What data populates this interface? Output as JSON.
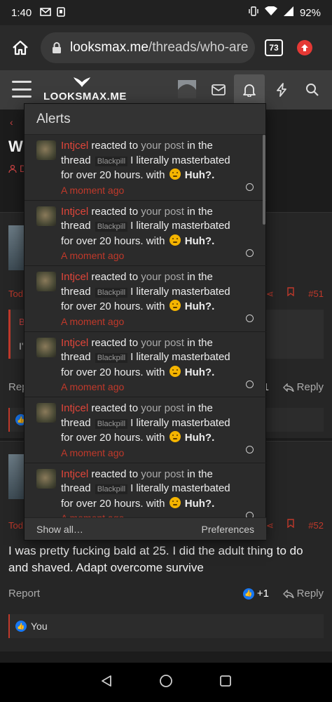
{
  "status_bar": {
    "time": "1:40",
    "battery": "92%"
  },
  "browser": {
    "url_domain": "looksmax.me",
    "url_path": "/threads/who-are",
    "tab_count": "73"
  },
  "site": {
    "logo_text": "LOOKSMAX.ME"
  },
  "background_page": {
    "title_fragment": "WI",
    "meta_fragment": "D",
    "back_fragment": "‹",
    "post1": {
      "date_fragment": "Tod",
      "number": "#51",
      "quote_fragment_a": "B",
      "quote_fragment_b": "I'",
      "report_fragment": "Rep",
      "plus": "1",
      "reply": "Reply"
    },
    "post2": {
      "date_fragment": "Tod",
      "number": "#52",
      "text": "I was pretty fucking bald at 25. I did the adult thing to do and shaved. Adapt overcome survive",
      "report": "Report",
      "plus": "+1",
      "reply": "Reply",
      "liked_by": "You"
    }
  },
  "alerts": {
    "title": "Alerts",
    "items": [
      {
        "user": "Intjcel",
        "action": "reacted to",
        "link": "your post",
        "context": "in the thread",
        "prefix": "Blackpill",
        "thread": "I literally masterbated for over 20 hours.",
        "with": "with",
        "reaction": "Huh?.",
        "time": "A moment ago"
      },
      {
        "user": "Intjcel",
        "action": "reacted to",
        "link": "your post",
        "context": "in the thread",
        "prefix": "Blackpill",
        "thread": "I literally masterbated for over 20 hours.",
        "with": "with",
        "reaction": "Huh?.",
        "time": "A moment ago"
      },
      {
        "user": "Intjcel",
        "action": "reacted to",
        "link": "your post",
        "context": "in the thread",
        "prefix": "Blackpill",
        "thread": "I literally masterbated for over 20 hours.",
        "with": "with",
        "reaction": "Huh?.",
        "time": "A moment ago"
      },
      {
        "user": "Intjcel",
        "action": "reacted to",
        "link": "your post",
        "context": "in the thread",
        "prefix": "Blackpill",
        "thread": "I literally masterbated for over 20 hours.",
        "with": "with",
        "reaction": "Huh?.",
        "time": "A moment ago"
      },
      {
        "user": "Intjcel",
        "action": "reacted to",
        "link": "your post",
        "context": "in the thread",
        "prefix": "Blackpill",
        "thread": "I literally masterbated for over 20 hours.",
        "with": "with",
        "reaction": "Huh?.",
        "time": "A moment ago"
      },
      {
        "user": "Intjcel",
        "action": "reacted to",
        "link": "your post",
        "context": "in the thread",
        "prefix": "Blackpill",
        "thread": "I literally masterbated for over 20 hours.",
        "with": "with",
        "reaction": "Huh?.",
        "time": "A moment ago"
      }
    ],
    "show_all": "Show all…",
    "preferences": "Preferences"
  },
  "colors": {
    "accent_red": "#c0392b",
    "username_red": "#e0453a",
    "like_blue": "#1877f2"
  }
}
